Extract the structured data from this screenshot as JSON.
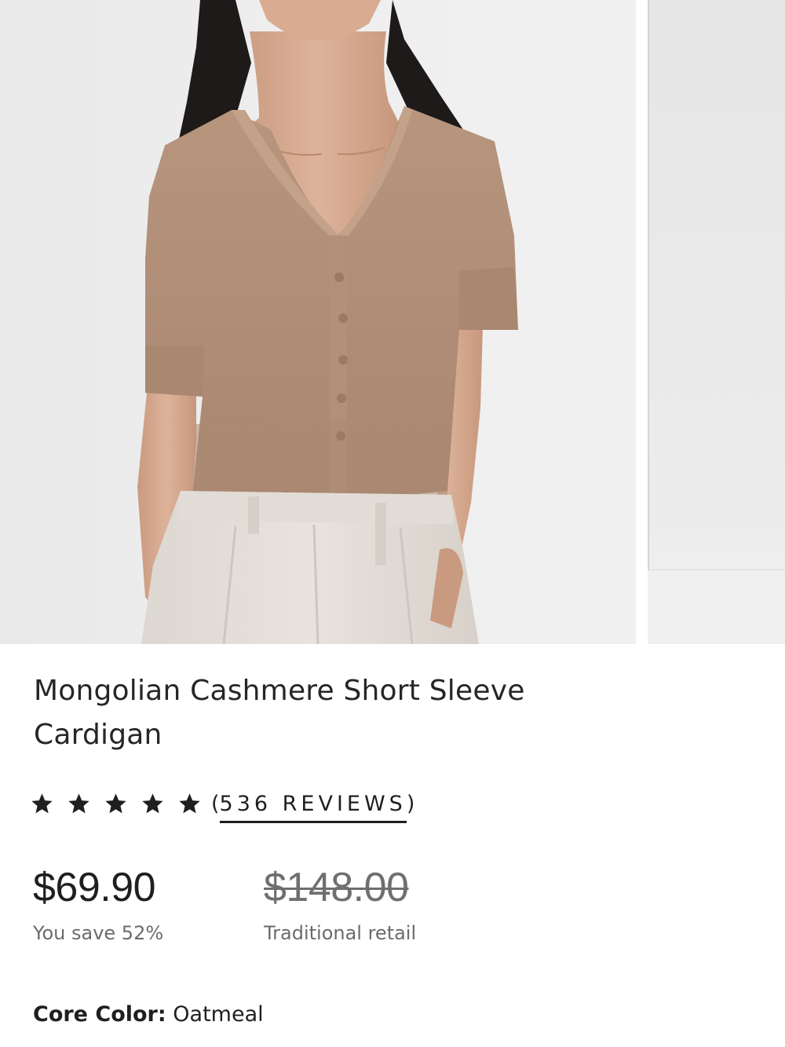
{
  "product": {
    "title": "Mongolian Cashmere Short Sleeve Cardigan",
    "rating": {
      "stars": 5,
      "max_stars": 5,
      "reviews_text": "536 REVIEWS",
      "open_paren": "(",
      "close_paren": ")"
    },
    "price": {
      "sale": "$69.90",
      "sale_caption": "You save 52%",
      "retail": "$148.00",
      "retail_caption": "Traditional retail"
    },
    "color": {
      "label": "Core Color:",
      "value": "Oatmeal"
    }
  },
  "colors": {
    "text": "#1f1f1f",
    "muted": "#6b6b6b",
    "sweater": "#b08c73",
    "trousers": "#e4dfda",
    "backdrop": "#ececec"
  },
  "icons": {
    "star": "star-icon"
  }
}
